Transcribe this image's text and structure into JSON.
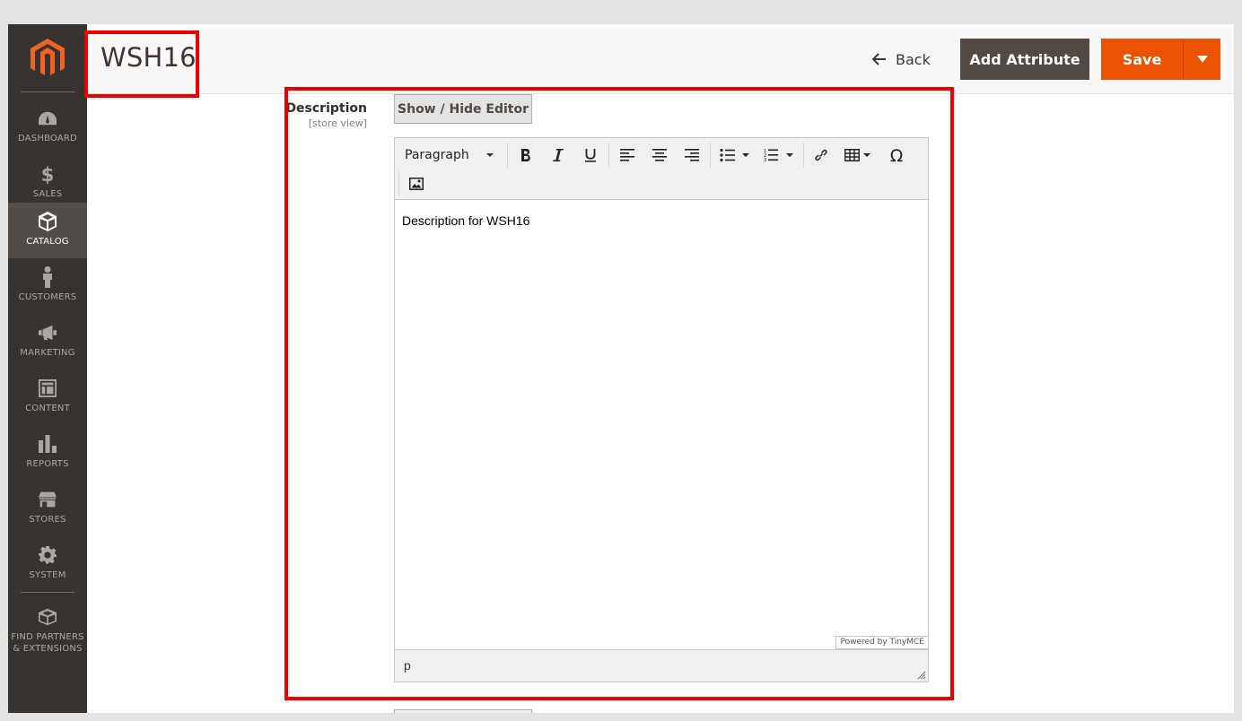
{
  "sidebar": {
    "items": [
      {
        "label": "DASHBOARD",
        "icon": "dashboard-icon"
      },
      {
        "label": "SALES",
        "icon": "dollar-icon"
      },
      {
        "label": "CATALOG",
        "icon": "cube-icon",
        "active": true
      },
      {
        "label": "CUSTOMERS",
        "icon": "person-icon"
      },
      {
        "label": "MARKETING",
        "icon": "megaphone-icon"
      },
      {
        "label": "CONTENT",
        "icon": "layout-icon"
      },
      {
        "label": "REPORTS",
        "icon": "bar-chart-icon"
      },
      {
        "label": "STORES",
        "icon": "store-icon"
      },
      {
        "label": "SYSTEM",
        "icon": "gear-icon"
      },
      {
        "label_line1": "FIND PARTNERS",
        "label_line2": "& EXTENSIONS",
        "icon": "blocks-icon"
      }
    ]
  },
  "header": {
    "title": "WSH16",
    "back_label": "Back",
    "add_attribute_label": "Add Attribute",
    "save_label": "Save"
  },
  "field": {
    "label": "Description",
    "scope": "[store view]",
    "toggle_label": "Show / Hide Editor"
  },
  "editor": {
    "format_value": "Paragraph",
    "content": "Description for WSH16",
    "powered_by": "Powered by TinyMCE",
    "path": "p"
  },
  "colors": {
    "accent": "#eb5202",
    "sidebar": "#373330",
    "highlight": "#ee0000"
  }
}
